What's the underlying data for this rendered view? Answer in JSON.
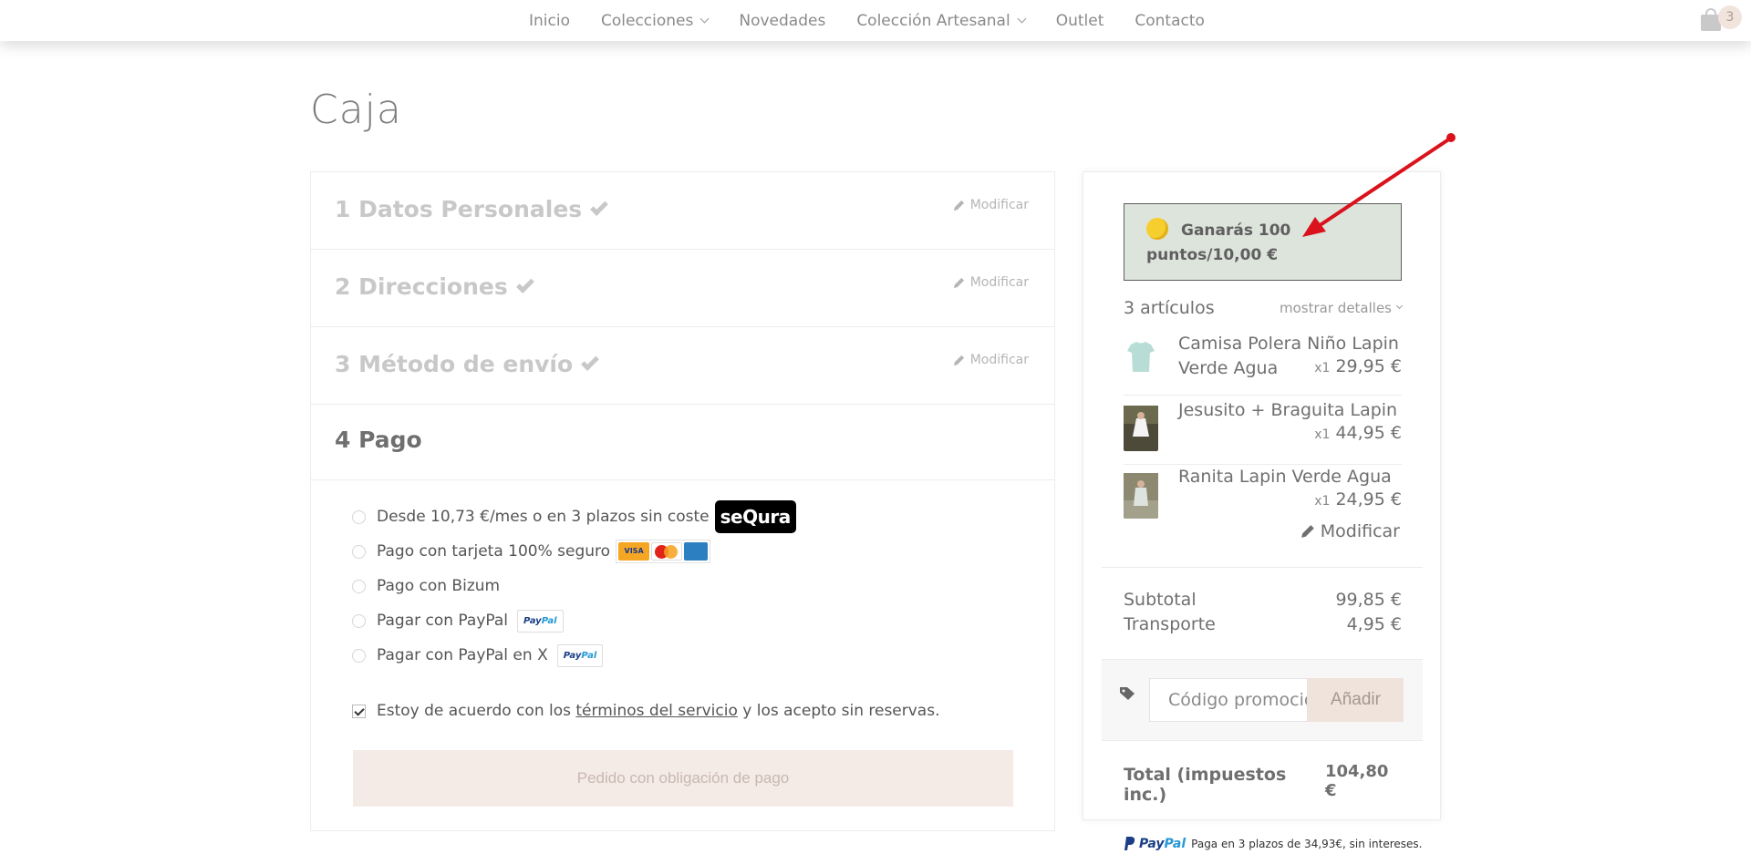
{
  "nav": {
    "items": [
      {
        "label": "Inicio",
        "dropdown": false
      },
      {
        "label": "Colecciones",
        "dropdown": true
      },
      {
        "label": "Novedades",
        "dropdown": false
      },
      {
        "label": "Colección Artesanal",
        "dropdown": true
      },
      {
        "label": "Outlet",
        "dropdown": false
      },
      {
        "label": "Contacto",
        "dropdown": false
      }
    ],
    "cart_count": "3"
  },
  "page": {
    "title": "Caja"
  },
  "steps": [
    {
      "label": "1 Datos Personales",
      "modify": "Modificar",
      "done": true
    },
    {
      "label": "2 Direcciones",
      "modify": "Modificar",
      "done": true
    },
    {
      "label": "3 Método de envío",
      "modify": "Modificar",
      "done": true
    },
    {
      "label": "4 Pago",
      "done": false
    }
  ],
  "payment": {
    "options": [
      "Desde 10,73 €/mes o en 3 plazos sin coste",
      "Pago con tarjeta 100% seguro",
      "Pago con Bizum",
      "Pagar con PayPal",
      "Pagar con PayPal en X"
    ],
    "sequra_logo": "seQura",
    "card_logos": [
      "VISA",
      "MasterCard",
      "AMEX"
    ],
    "paypal_badge": {
      "pay": "Pay",
      "pal": "Pal"
    },
    "terms_before": "Estoy de acuerdo con los ",
    "terms_link": "términos del servicio",
    "terms_after": " y los acepto sin reservas.",
    "terms_checked": true,
    "order_button": "Pedido con obligación de pago"
  },
  "summary": {
    "points_line1": "Ganarás 100",
    "points_line2": "puntos/10,00 €",
    "items_count": "3 artículos",
    "show_details": "mostrar detalles",
    "items": [
      {
        "name": "Camisa Polera Niño Lapin Verde Agua",
        "qty": "x1",
        "price": "29,95 €"
      },
      {
        "name": "Jesusito + Braguita Lapin",
        "qty": "x1",
        "price": "44,95 €"
      },
      {
        "name": "Ranita Lapin Verde Agua",
        "qty": "x1",
        "price": "24,95 €"
      }
    ],
    "modify": "Modificar",
    "subtotal_label": "Subtotal",
    "subtotal_value": "99,85 €",
    "shipping_label": "Transporte",
    "shipping_value": "4,95 €",
    "promo_placeholder": "Código promocional",
    "promo_button": "Añadir",
    "total_label": "Total (impuestos inc.)",
    "total_value": "104,80 €"
  },
  "paypal_promo": {
    "pay": "Pay",
    "pal": "Pal",
    "text": "Paga en 3 plazos de 34,93€, sin intereses."
  },
  "colors": {
    "accent_peach": "#f5ebe6",
    "points_bg": "#dde4dc",
    "arrow_red": "#d9121c"
  }
}
